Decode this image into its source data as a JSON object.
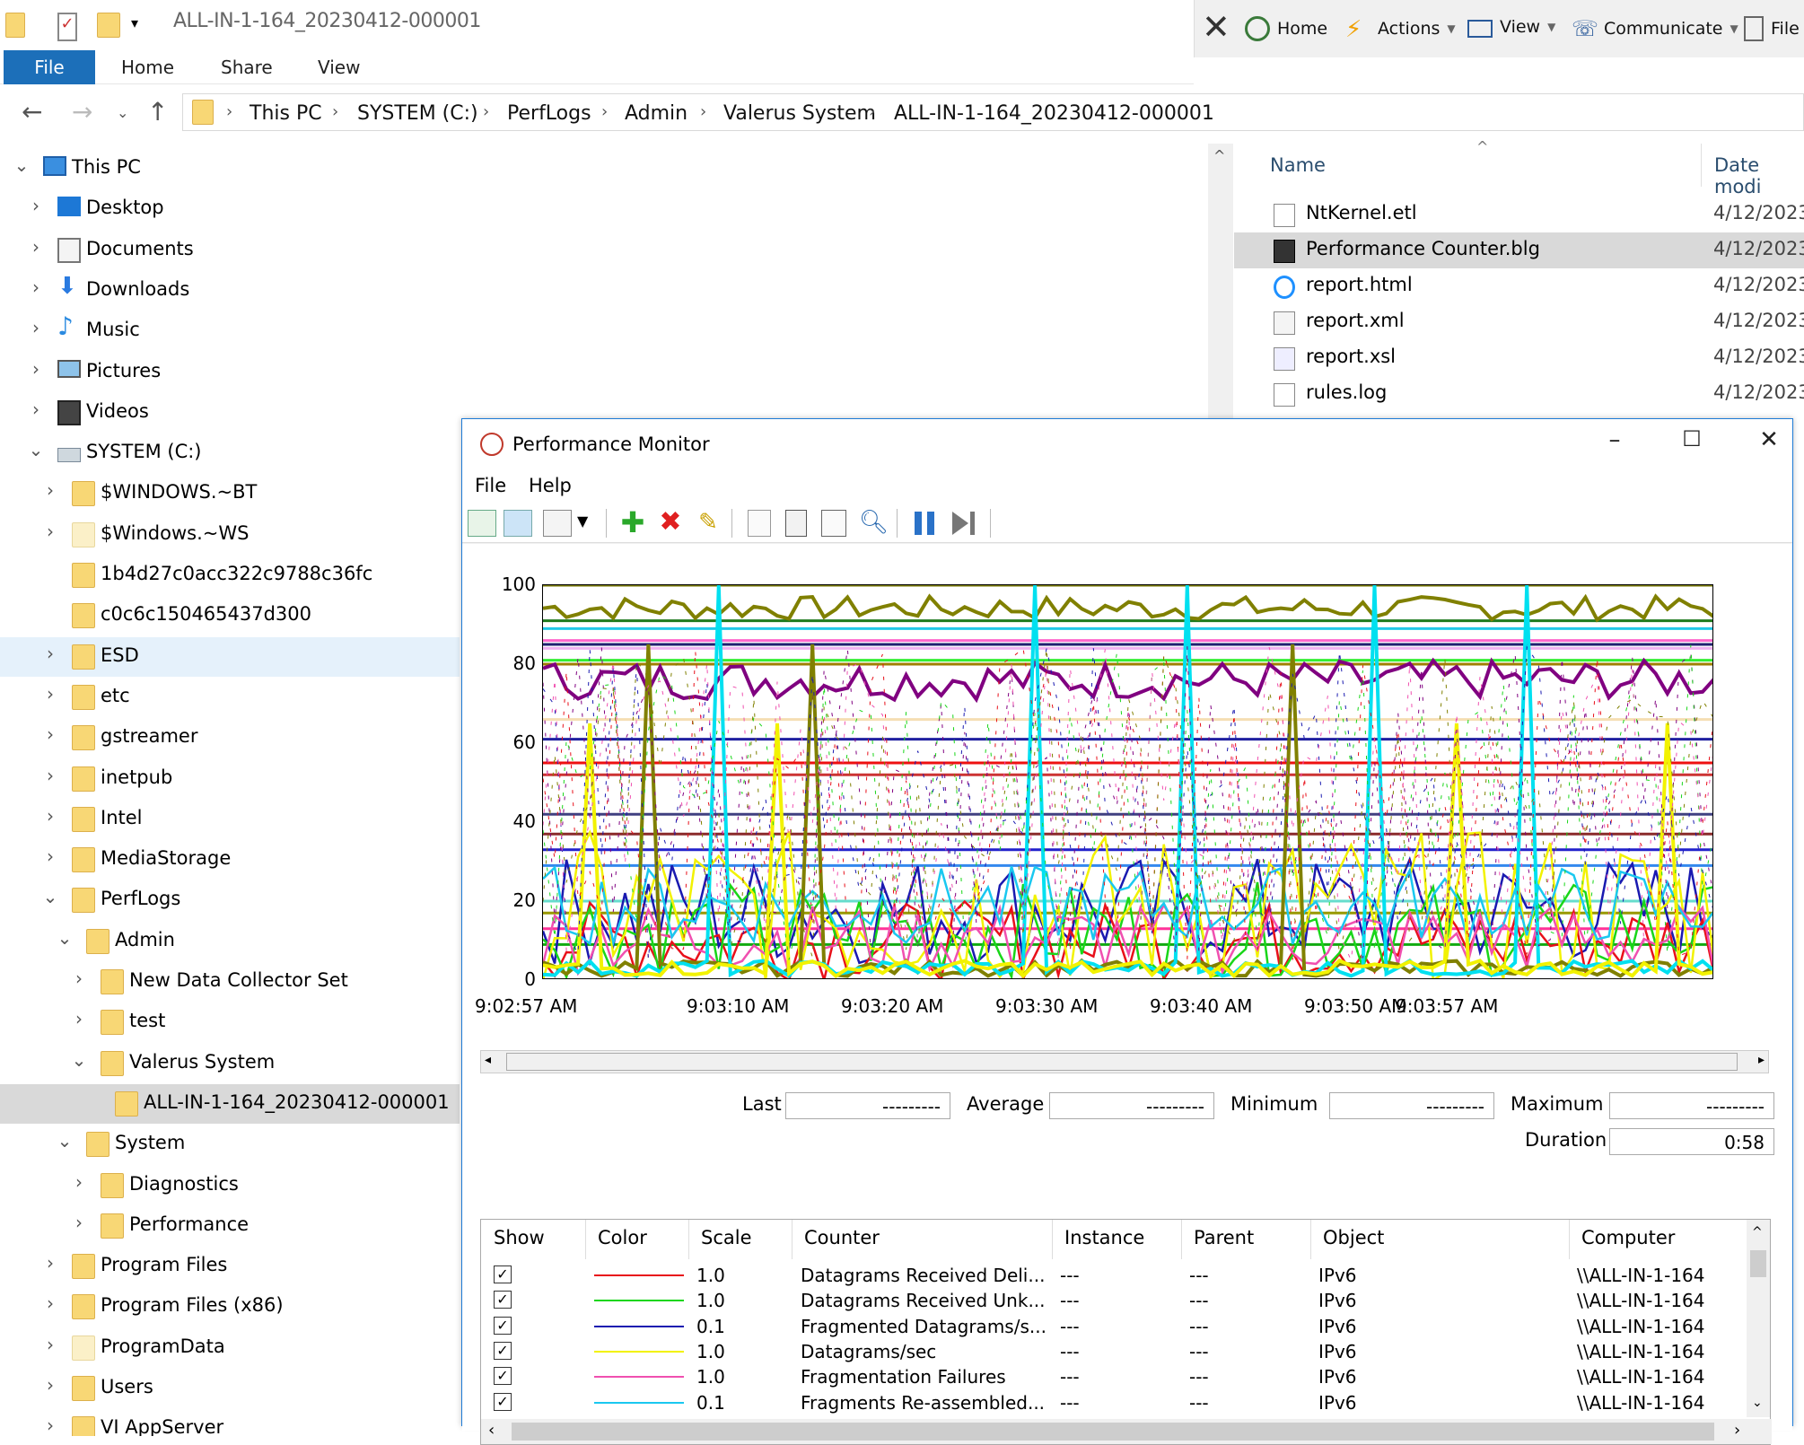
{
  "explorer": {
    "title": "ALL-IN-1-164_20230412-000001",
    "command_bar": [
      {
        "label": "Home",
        "icon": "refresh-icon"
      },
      {
        "label": "Actions",
        "icon": "lightning-icon"
      },
      {
        "label": "View",
        "icon": "monitor-icon"
      },
      {
        "label": "Communicate",
        "icon": "phone-icon"
      },
      {
        "label": "File",
        "icon": "file-transfer-icon"
      }
    ],
    "ribbon_tabs": [
      "File",
      "Home",
      "Share",
      "View"
    ],
    "breadcrumb": [
      "This PC",
      "SYSTEM (C:)",
      "PerfLogs",
      "Admin",
      "Valerus System",
      "ALL-IN-1-164_20230412-000001"
    ],
    "tree": [
      {
        "label": "This PC",
        "level": 0,
        "expanded": true,
        "icon": "computer-icon"
      },
      {
        "label": "Desktop",
        "level": 1,
        "icon": "desktop-icon"
      },
      {
        "label": "Documents",
        "level": 1,
        "icon": "documents-icon"
      },
      {
        "label": "Downloads",
        "level": 1,
        "icon": "downloads-icon"
      },
      {
        "label": "Music",
        "level": 1,
        "icon": "music-icon"
      },
      {
        "label": "Pictures",
        "level": 1,
        "icon": "pictures-icon"
      },
      {
        "label": "Videos",
        "level": 1,
        "icon": "videos-icon"
      },
      {
        "label": "SYSTEM (C:)",
        "level": 1,
        "expanded": true,
        "icon": "drive-icon"
      },
      {
        "label": "$WINDOWS.~BT",
        "level": 2,
        "icon": "folder-icon"
      },
      {
        "label": "$Windows.~WS",
        "level": 2,
        "icon": "folder-icon",
        "pale": true
      },
      {
        "label": "1b4d27c0acc322c9788c36fc",
        "level": 2,
        "icon": "folder-icon",
        "nochev": true
      },
      {
        "label": "c0c6c150465437d300",
        "level": 2,
        "icon": "folder-icon",
        "nochev": true
      },
      {
        "label": "ESD",
        "level": 2,
        "icon": "folder-icon",
        "hover": true
      },
      {
        "label": "etc",
        "level": 2,
        "icon": "folder-icon"
      },
      {
        "label": "gstreamer",
        "level": 2,
        "icon": "folder-icon"
      },
      {
        "label": "inetpub",
        "level": 2,
        "icon": "folder-icon"
      },
      {
        "label": "Intel",
        "level": 2,
        "icon": "folder-icon"
      },
      {
        "label": "MediaStorage",
        "level": 2,
        "icon": "folder-icon"
      },
      {
        "label": "PerfLogs",
        "level": 2,
        "expanded": true,
        "icon": "folder-icon"
      },
      {
        "label": "Admin",
        "level": 3,
        "expanded": true,
        "icon": "folder-icon"
      },
      {
        "label": "New Data Collector Set",
        "level": 4,
        "icon": "folder-icon"
      },
      {
        "label": "test",
        "level": 4,
        "icon": "folder-icon"
      },
      {
        "label": "Valerus System",
        "level": 4,
        "expanded": true,
        "icon": "folder-icon"
      },
      {
        "label": "ALL-IN-1-164_20230412-000001",
        "level": 5,
        "icon": "folder-icon",
        "selected": true,
        "nochev": true
      },
      {
        "label": "System",
        "level": 3,
        "expanded": true,
        "icon": "folder-icon"
      },
      {
        "label": "Diagnostics",
        "level": 4,
        "icon": "folder-icon"
      },
      {
        "label": "Performance",
        "level": 4,
        "icon": "folder-icon"
      },
      {
        "label": "Program Files",
        "level": 2,
        "icon": "folder-icon"
      },
      {
        "label": "Program Files (x86)",
        "level": 2,
        "icon": "folder-icon"
      },
      {
        "label": "ProgramData",
        "level": 2,
        "icon": "folder-icon",
        "pale": true
      },
      {
        "label": "Users",
        "level": 2,
        "icon": "folder-icon"
      },
      {
        "label": "VI AppServer",
        "level": 2,
        "icon": "folder-icon"
      }
    ],
    "columns": {
      "name": "Name",
      "date": "Date modi"
    },
    "files": [
      {
        "name": "NtKernel.etl",
        "date": "4/12/2023",
        "icon": "generic-file-icon"
      },
      {
        "name": "Performance Counter.blg",
        "date": "4/12/2023",
        "icon": "perf-log-icon",
        "selected": true
      },
      {
        "name": "report.html",
        "date": "4/12/2023",
        "icon": "ie-html-icon"
      },
      {
        "name": "report.xml",
        "date": "4/12/2023",
        "icon": "xml-file-icon"
      },
      {
        "name": "report.xsl",
        "date": "4/12/2023",
        "icon": "xsl-file-icon"
      },
      {
        "name": "rules.log",
        "date": "4/12/2023",
        "icon": "text-file-icon"
      }
    ]
  },
  "perfmon": {
    "title": "Performance Monitor",
    "menus": [
      "File",
      "Help"
    ],
    "stats": {
      "last_label": "Last",
      "last": "---------",
      "average_label": "Average",
      "average": "---------",
      "minimum_label": "Minimum",
      "minimum": "---------",
      "maximum_label": "Maximum",
      "maximum": "---------",
      "duration_label": "Duration",
      "duration": "0:58"
    },
    "table_headers": [
      "Show",
      "Color",
      "Scale",
      "Counter",
      "Instance",
      "Parent",
      "Object",
      "Computer"
    ],
    "counters": [
      {
        "color": "#e8101a",
        "scale": "1.0",
        "counter": "Datagrams Received Deli...",
        "instance": "---",
        "parent": "---",
        "object": "IPv6",
        "computer": "\\\\ALL-IN-1-164"
      },
      {
        "color": "#19d619",
        "scale": "1.0",
        "counter": "Datagrams Received Unk...",
        "instance": "---",
        "parent": "---",
        "object": "IPv6",
        "computer": "\\\\ALL-IN-1-164"
      },
      {
        "color": "#1a1ab0",
        "scale": "0.1",
        "counter": "Fragmented Datagrams/s...",
        "instance": "---",
        "parent": "---",
        "object": "IPv6",
        "computer": "\\\\ALL-IN-1-164"
      },
      {
        "color": "#f2f200",
        "scale": "1.0",
        "counter": "Datagrams/sec",
        "instance": "---",
        "parent": "---",
        "object": "IPv6",
        "computer": "\\\\ALL-IN-1-164"
      },
      {
        "color": "#f050b0",
        "scale": "1.0",
        "counter": "Fragmentation Failures",
        "instance": "---",
        "parent": "---",
        "object": "IPv6",
        "computer": "\\\\ALL-IN-1-164"
      },
      {
        "color": "#1ac8f0",
        "scale": "0.1",
        "counter": "Fragments Re-assembled...",
        "instance": "---",
        "parent": "---",
        "object": "IPv6",
        "computer": "\\\\ALL-IN-1-164"
      }
    ]
  },
  "chart_data": {
    "type": "line",
    "ylim": [
      0,
      100
    ],
    "yticks": [
      "100",
      "80",
      "60",
      "40",
      "20",
      "0"
    ],
    "xticks": [
      "9:02:57 AM",
      "9:03:10 AM",
      "9:03:20 AM",
      "9:03:30 AM",
      "9:03:40 AM",
      "9:03:50 AM",
      "9:03:57 AM"
    ],
    "grid": false,
    "legend": "table-below",
    "flat_series": [
      {
        "color": "#7a7a00",
        "value": 100
      },
      {
        "color": "#1e7a1e",
        "value": 91
      },
      {
        "color": "#20c8e8",
        "value": 89
      },
      {
        "color": "#ff66cc",
        "value": 86
      },
      {
        "color": "#202070",
        "value": 85
      },
      {
        "color": "#f0b0f0",
        "value": 84
      },
      {
        "color": "#33ee33",
        "value": 81
      },
      {
        "color": "#a08000",
        "value": 80
      },
      {
        "color": "#f5deb3",
        "value": 66
      },
      {
        "color": "#2020a0",
        "value": 61
      },
      {
        "color": "#ee1010",
        "value": 55
      },
      {
        "color": "#cc3333",
        "value": 52
      },
      {
        "color": "#404080",
        "value": 42
      },
      {
        "color": "#8a2a2a",
        "value": 37
      },
      {
        "color": "#2222cc",
        "value": 33
      },
      {
        "color": "#3388ee",
        "value": 29
      },
      {
        "color": "#66ddcc",
        "value": 20
      },
      {
        "color": "#999900",
        "value": 17
      },
      {
        "color": "#ff3399",
        "value": 13
      },
      {
        "color": "#11aa11",
        "value": 9
      }
    ],
    "noisy_series": [
      {
        "color": "#808000",
        "base": 93,
        "amp": 3
      },
      {
        "color": "#800080",
        "base": 74,
        "amp": 5
      },
      {
        "color": "#1a1ab0",
        "base": 12,
        "amp": 14
      },
      {
        "color": "#e8101a",
        "base": 6,
        "amp": 10
      },
      {
        "color": "#19d619",
        "base": 8,
        "amp": 12
      },
      {
        "color": "#f2f200",
        "base": 10,
        "amp": 20
      },
      {
        "color": "#f050b0",
        "base": 7,
        "amp": 9
      },
      {
        "color": "#1ac8f0",
        "base": 15,
        "amp": 10
      }
    ],
    "spike_series": [
      {
        "color": "#808000",
        "spikes_at": [
          9,
          23,
          64
        ],
        "peak": 85
      },
      {
        "color": "#00e0f0",
        "spikes_at": [
          15,
          42,
          55,
          71,
          84
        ],
        "peak": 100
      },
      {
        "color": "#f2f200",
        "spikes_at": [
          4,
          20,
          78,
          96
        ],
        "peak": 65
      }
    ]
  }
}
